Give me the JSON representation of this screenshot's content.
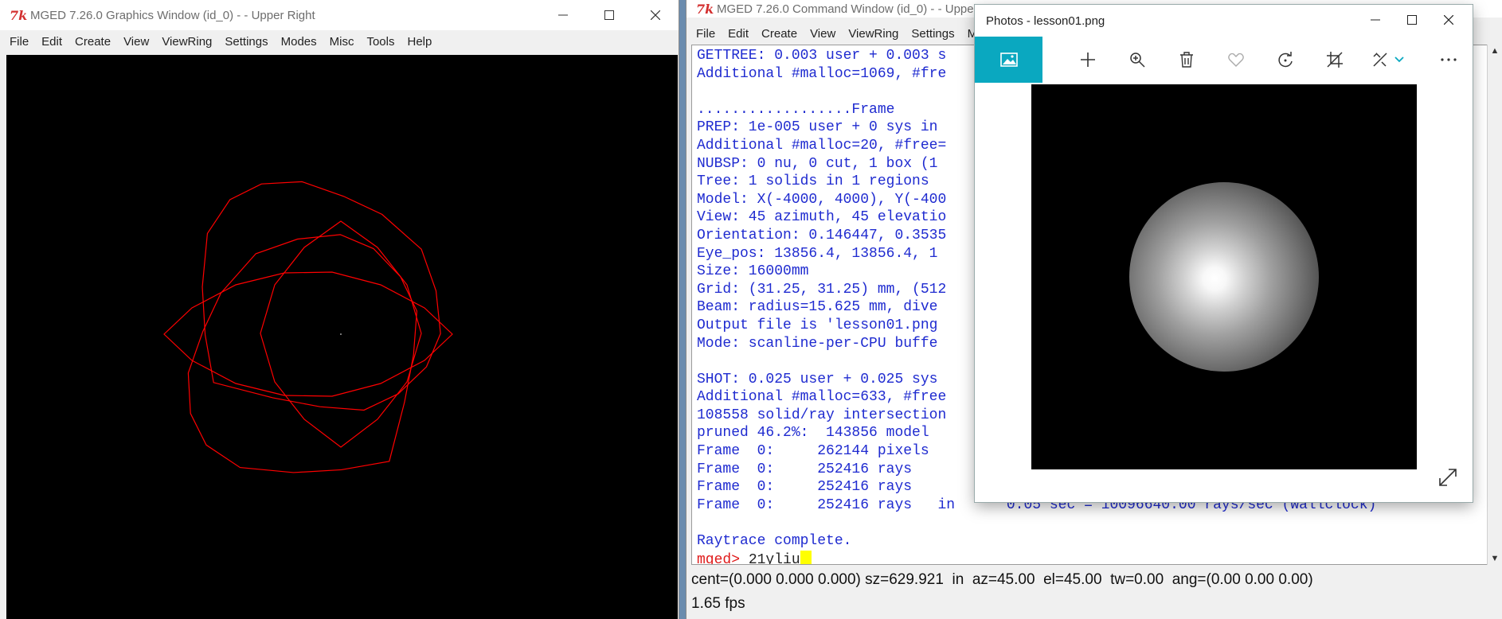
{
  "graphics_window": {
    "title": "MGED 7.26.0 Graphics Window (id_0) -  - Upper Right",
    "menu": [
      "File",
      "Edit",
      "Create",
      "View",
      "ViewRing",
      "Settings",
      "Modes",
      "Misc",
      "Tools",
      "Help"
    ]
  },
  "command_window": {
    "title": "MGED 7.26.0 Command Window (id_0) -  - Upper",
    "menu": [
      "File",
      "Edit",
      "Create",
      "View",
      "ViewRing",
      "Settings",
      "M"
    ],
    "console_lines": [
      "GETTREE: 0.003 user + 0.003 s",
      "Additional #malloc=1069, #fre",
      "",
      "..................Frame",
      "PREP: 1e-005 user + 0 sys in",
      "Additional #malloc=20, #free=",
      "NUBSP: 0 nu, 0 cut, 1 box (1",
      "Tree: 1 solids in 1 regions",
      "Model: X(-4000, 4000), Y(-400",
      "View: 45 azimuth, 45 elevatio",
      "Orientation: 0.146447, 0.3535",
      "Eye_pos: 13856.4, 13856.4, 1",
      "Size: 16000mm",
      "Grid: (31.25, 31.25) mm, (512",
      "Beam: radius=15.625 mm, dive",
      "Output file is 'lesson01.png",
      "Mode: scanline-per-CPU buffe",
      "",
      "SHOT: 0.025 user + 0.025 sys",
      "Additional #malloc=633, #free",
      "108558 solid/ray intersection",
      "pruned 46.2%:  143856 model",
      "Frame  0:     262144 pixels",
      "Frame  0:     252416 rays",
      "Frame  0:     252416 rays",
      "Frame  0:     252416 rays   in      0.05 sec = 10096640.00 rays/sec (wallclock)",
      "",
      "Raytrace complete."
    ],
    "prompt": "mged>",
    "input_value": "21yliu",
    "status_line": "cent=(0.000 0.000 0.000) sz=629.921  in  az=45.00  el=45.00  tw=0.00  ang=(0.00 0.00 0.00)",
    "fps": "1.65 fps"
  },
  "photos_window": {
    "title": "Photos - lesson01.png",
    "toolbar_icons": [
      "image-icon",
      "add-icon",
      "zoom-icon",
      "delete-icon",
      "favorite-icon",
      "rotate-icon",
      "crop-icon",
      "edit-icon",
      "more-icon"
    ]
  },
  "colors": {
    "wireframe": "#ff0000",
    "console_text": "#1f2bd0",
    "prompt": "#e01a1a",
    "photos_accent": "#0aa8c0",
    "cursor": "#ffff00"
  }
}
